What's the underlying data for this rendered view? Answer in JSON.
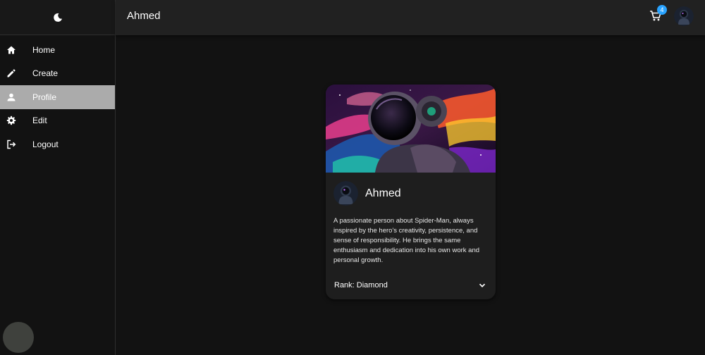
{
  "sidebar": {
    "logo_icon": "moon-icon",
    "items": [
      {
        "label": "Home",
        "icon": "home-icon",
        "active": false
      },
      {
        "label": "Create",
        "icon": "pencil-icon",
        "active": false
      },
      {
        "label": "Profile",
        "icon": "person-icon",
        "active": true
      },
      {
        "label": "Edit",
        "icon": "gear-icon",
        "active": false
      },
      {
        "label": "Logout",
        "icon": "logout-icon",
        "active": false
      }
    ]
  },
  "topbar": {
    "title": "Ahmed",
    "cart_icon": "cart-icon",
    "cart_count": "4",
    "avatar_icon": "astronaut-avatar"
  },
  "profile_card": {
    "media": "astronaut-artwork",
    "name": "Ahmed",
    "bio": "A passionate person about Spider-Man, always inspired by the hero's creativity, persistence, and sense of responsibility. He brings the same enthusiasm and dedication into his own work and personal growth.",
    "rank": "Rank: Diamond",
    "expand_icon": "chevron-down-icon"
  },
  "colors": {
    "background": "#121212",
    "appbar": "#212121",
    "card": "#1e1e1e",
    "active_nav": "#ababab",
    "badge": "#29a3ff"
  }
}
